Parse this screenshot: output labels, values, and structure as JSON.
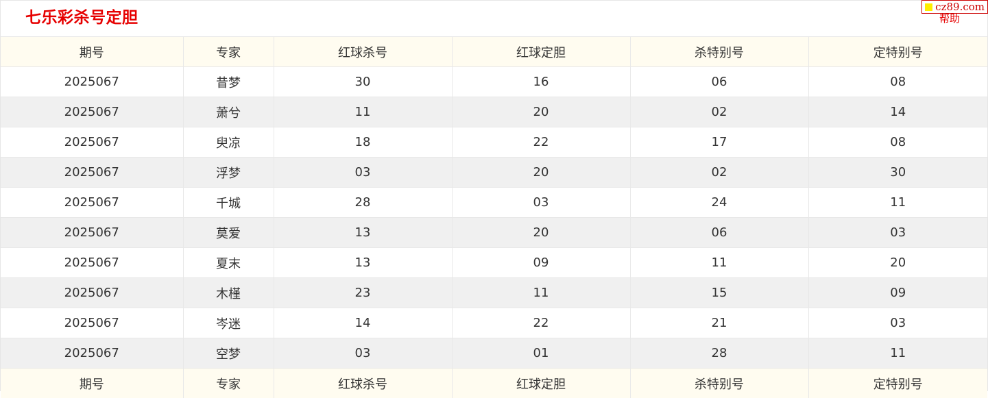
{
  "header": {
    "title": "七乐彩杀号定胆",
    "badge_text": "cz89.com",
    "help_label": "帮助"
  },
  "colors": {
    "title": "#e60000",
    "header_row_bg": "#fffcf0",
    "striped_row_bg": "#f0f0f0",
    "badge_square": "#ffee00"
  },
  "table": {
    "columns": [
      "期号",
      "专家",
      "红球杀号",
      "红球定胆",
      "杀特别号",
      "定特别号"
    ],
    "rows": [
      [
        "2025067",
        "昔梦",
        "30",
        "16",
        "06",
        "08"
      ],
      [
        "2025067",
        "萧兮",
        "11",
        "20",
        "02",
        "14"
      ],
      [
        "2025067",
        "臾凉",
        "18",
        "22",
        "17",
        "08"
      ],
      [
        "2025067",
        "浮梦",
        "03",
        "20",
        "02",
        "30"
      ],
      [
        "2025067",
        "千城",
        "28",
        "03",
        "24",
        "11"
      ],
      [
        "2025067",
        "莫爱",
        "13",
        "20",
        "06",
        "03"
      ],
      [
        "2025067",
        "夏末",
        "13",
        "09",
        "11",
        "20"
      ],
      [
        "2025067",
        "木槿",
        "23",
        "11",
        "15",
        "09"
      ],
      [
        "2025067",
        "岑迷",
        "14",
        "22",
        "21",
        "03"
      ],
      [
        "2025067",
        "空梦",
        "03",
        "01",
        "28",
        "11"
      ]
    ]
  }
}
